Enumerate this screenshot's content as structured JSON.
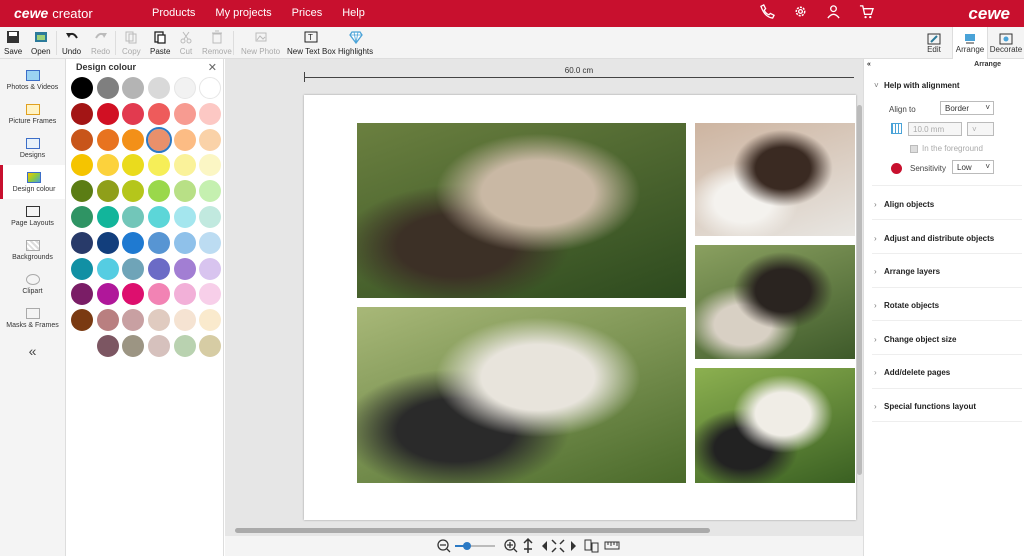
{
  "header": {
    "brand": "cewe",
    "brand_sub": "creator",
    "nav": [
      "Products",
      "My projects",
      "Prices",
      "Help"
    ],
    "logo": "cewe",
    "icons": [
      "phone-icon",
      "gear-icon",
      "user-icon",
      "cart-icon"
    ]
  },
  "toolbar": {
    "save": "Save",
    "open": "Open",
    "undo": "Undo",
    "redo": "Redo",
    "copy": "Copy",
    "paste": "Paste",
    "cut": "Cut",
    "remove": "Remove",
    "new_photo": "New Photo",
    "new_text_box": "New Text Box",
    "highlights": "Highlights"
  },
  "right_tabs": [
    "Edit",
    "Arrange",
    "Decorate"
  ],
  "left_nav": [
    "Photos & Videos",
    "Picture Frames",
    "Designs",
    "Design colour",
    "Page Layouts",
    "Backgrounds",
    "Clipart",
    "Masks & Frames"
  ],
  "color_panel": {
    "title": "Design colour",
    "swatches": [
      [
        "#000000",
        "#7f7f7f",
        "#b4b4b4",
        "#d9d9d9",
        "#f2f2f2",
        "#ffffff"
      ],
      [
        "#a31515",
        "#d11023",
        "#e23a4f",
        "#ee5b5b",
        "#f79b91",
        "#fcc8c4"
      ],
      [
        "#c8551a",
        "#e8731f",
        "#f39018",
        "#e9906b",
        "#fcbc84",
        "#fad2a8"
      ],
      [
        "#f5c400",
        "#fcd23c",
        "#eadb1d",
        "#f6ee58",
        "#faf29a",
        "#fbf6c4"
      ],
      [
        "#5b7d14",
        "#8f9f1a",
        "#b5c61b",
        "#9ad84b",
        "#b8e086",
        "#c5f0b0"
      ],
      [
        "#2f9464",
        "#12b59b",
        "#72c6b9",
        "#5cd6d8",
        "#a4e6ee",
        "#c1e9df"
      ],
      [
        "#283a69",
        "#123e7c",
        "#1f7ad1",
        "#5795d3",
        "#8fc1ea",
        "#bcdcf2"
      ],
      [
        "#1190a4",
        "#55cde2",
        "#6fa4b8",
        "#6b6bc6",
        "#a27ed3",
        "#d8c4ef"
      ],
      [
        "#7a1d66",
        "#b0179a",
        "#dd0f6e",
        "#f283b4",
        "#f2b0d8",
        "#f7cfe9"
      ],
      [
        "#7a3a12",
        "#b97f80",
        "#c8a0a2",
        "#e0cbc0",
        "#f5e3d2",
        "#faeacd"
      ],
      [
        null,
        "#7c5662",
        "#9c9583",
        "#d6c1bd",
        "#b9d2b0",
        "#d6cca4"
      ]
    ],
    "selected": [
      2,
      3
    ]
  },
  "ruler": {
    "label": "60.0 cm"
  },
  "right_panel": {
    "header": "Arrange",
    "help_title": "Help with alignment",
    "align_to_label": "Align to",
    "align_to_value": "Border",
    "spacing_value": "10.0 mm",
    "foreground_label": "In the foreground",
    "sensitivity_label": "Sensitivity",
    "sensitivity_value": "Low",
    "sections": [
      "Align objects",
      "Adjust and distribute objects",
      "Arrange layers",
      "Rotate objects",
      "Change object size",
      "Add/delete pages",
      "Special functions layout"
    ]
  },
  "photos": [
    {
      "name": "photo-brides-kiss",
      "colors": [
        "#2d4a1e",
        "#6b8040",
        "#c9b8a4",
        "#3c3026"
      ]
    },
    {
      "name": "photo-makeup",
      "colors": [
        "#e8e6e2",
        "#cdb4a0",
        "#3a2a22",
        "#f4f2ee"
      ]
    },
    {
      "name": "photo-group-laughing",
      "colors": [
        "#3e5a2a",
        "#8aa060",
        "#2a2420",
        "#d8d0c4"
      ]
    },
    {
      "name": "photo-brides-hug",
      "colors": [
        "#4a6a2a",
        "#a8b878",
        "#e8e4dc",
        "#2a2a2a"
      ]
    },
    {
      "name": "photo-guests-dancing",
      "colors": [
        "#3a6022",
        "#8cb050",
        "#f0ede6",
        "#222"
      ]
    }
  ]
}
